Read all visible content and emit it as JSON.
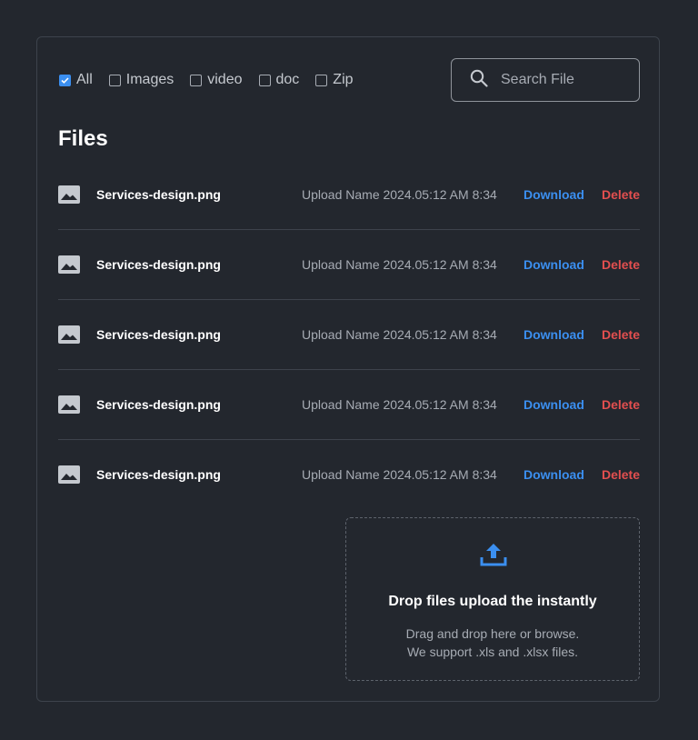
{
  "filters": [
    {
      "label": "All",
      "checked": true
    },
    {
      "label": "Images",
      "checked": false
    },
    {
      "label": "video",
      "checked": false
    },
    {
      "label": "doc",
      "checked": false
    },
    {
      "label": "Zip",
      "checked": false
    }
  ],
  "search": {
    "placeholder": "Search File",
    "value": ""
  },
  "files_title": "Files",
  "files": [
    {
      "name": "Services-design.png",
      "meta": "Upload Name 2024.05:12 AM 8:34",
      "download_label": "Download",
      "delete_label": "Delete"
    },
    {
      "name": "Services-design.png",
      "meta": "Upload Name 2024.05:12 AM 8:34",
      "download_label": "Download",
      "delete_label": "Delete"
    },
    {
      "name": "Services-design.png",
      "meta": "Upload Name 2024.05:12 AM 8:34",
      "download_label": "Download",
      "delete_label": "Delete"
    },
    {
      "name": "Services-design.png",
      "meta": "Upload Name 2024.05:12 AM 8:34",
      "download_label": "Download",
      "delete_label": "Delete"
    },
    {
      "name": "Services-design.png",
      "meta": "Upload Name 2024.05:12 AM 8:34",
      "download_label": "Download",
      "delete_label": "Delete"
    }
  ],
  "dropzone": {
    "title": "Drop files upload the instantly",
    "line1": "Drag and drop here or browse.",
    "line2": "We support .xls and .xlsx files."
  },
  "icons": {
    "file": "image-file-icon",
    "search": "search-icon",
    "upload": "upload-icon"
  },
  "colors": {
    "background": "#23272e",
    "accent": "#3b8ff0",
    "danger": "#e24f4f",
    "text": "#ffffff",
    "muted": "#a7acb4",
    "border": "#3d434c"
  }
}
